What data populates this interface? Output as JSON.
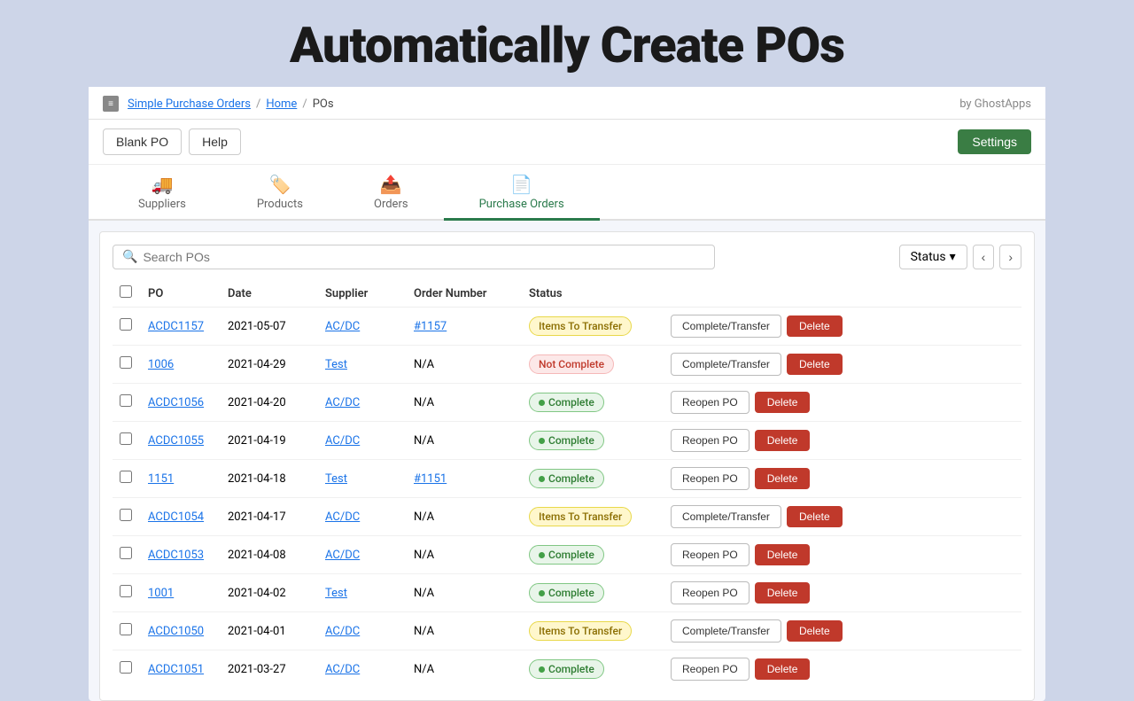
{
  "page": {
    "title": "Automatically Create POs",
    "breadcrumb": [
      "Simple Purchase Orders",
      "Home",
      "POs"
    ],
    "by": "by GhostApps"
  },
  "toolbar": {
    "blank_po": "Blank PO",
    "help": "Help",
    "settings": "Settings"
  },
  "tabs": [
    {
      "id": "suppliers",
      "label": "Suppliers",
      "icon": "🚚",
      "active": false
    },
    {
      "id": "products",
      "label": "Products",
      "icon": "🏷️",
      "active": false
    },
    {
      "id": "orders",
      "label": "Orders",
      "icon": "📤",
      "active": false
    },
    {
      "id": "purchase-orders",
      "label": "Purchase Orders",
      "icon": "📄",
      "active": true
    }
  ],
  "search": {
    "placeholder": "Search POs"
  },
  "filter": {
    "status_label": "Status",
    "prev_label": "‹",
    "next_label": "›"
  },
  "table": {
    "columns": [
      "",
      "PO",
      "Date",
      "Supplier",
      "Order Number",
      "Status",
      ""
    ],
    "rows": [
      {
        "id": "ACDC1157",
        "date": "2021-05-07",
        "supplier": "AC/DC",
        "order_number": "#1157",
        "order_is_link": true,
        "status": "Items To Transfer",
        "status_type": "items-transfer",
        "action1": "Complete/Transfer",
        "action2": "Delete"
      },
      {
        "id": "1006",
        "date": "2021-04-29",
        "supplier": "Test",
        "order_number": "N/A",
        "order_is_link": false,
        "status": "Not Complete",
        "status_type": "not-complete",
        "action1": "Complete/Transfer",
        "action2": "Delete"
      },
      {
        "id": "ACDC1056",
        "date": "2021-04-20",
        "supplier": "AC/DC",
        "order_number": "N/A",
        "order_is_link": false,
        "status": "Complete",
        "status_type": "complete",
        "action1": "Reopen PO",
        "action2": "Delete"
      },
      {
        "id": "ACDC1055",
        "date": "2021-04-19",
        "supplier": "AC/DC",
        "order_number": "N/A",
        "order_is_link": false,
        "status": "Complete",
        "status_type": "complete",
        "action1": "Reopen PO",
        "action2": "Delete"
      },
      {
        "id": "1151",
        "date": "2021-04-18",
        "supplier": "Test",
        "order_number": "#1151",
        "order_is_link": true,
        "status": "Complete",
        "status_type": "complete",
        "action1": "Reopen PO",
        "action2": "Delete"
      },
      {
        "id": "ACDC1054",
        "date": "2021-04-17",
        "supplier": "AC/DC",
        "order_number": "N/A",
        "order_is_link": false,
        "status": "Items To Transfer",
        "status_type": "items-transfer",
        "action1": "Complete/Transfer",
        "action2": "Delete"
      },
      {
        "id": "ACDC1053",
        "date": "2021-04-08",
        "supplier": "AC/DC",
        "order_number": "N/A",
        "order_is_link": false,
        "status": "Complete",
        "status_type": "complete",
        "action1": "Reopen PO",
        "action2": "Delete"
      },
      {
        "id": "1001",
        "date": "2021-04-02",
        "supplier": "Test",
        "order_number": "N/A",
        "order_is_link": false,
        "status": "Complete",
        "status_type": "complete",
        "action1": "Reopen PO",
        "action2": "Delete"
      },
      {
        "id": "ACDC1050",
        "date": "2021-04-01",
        "supplier": "AC/DC",
        "order_number": "N/A",
        "order_is_link": false,
        "status": "Items To Transfer",
        "status_type": "items-transfer",
        "action1": "Complete/Transfer",
        "action2": "Delete"
      },
      {
        "id": "ACDC1051",
        "date": "2021-03-27",
        "supplier": "AC/DC",
        "order_number": "N/A",
        "order_is_link": false,
        "status": "Complete",
        "status_type": "complete",
        "action1": "Reopen PO",
        "action2": "Delete"
      }
    ]
  }
}
